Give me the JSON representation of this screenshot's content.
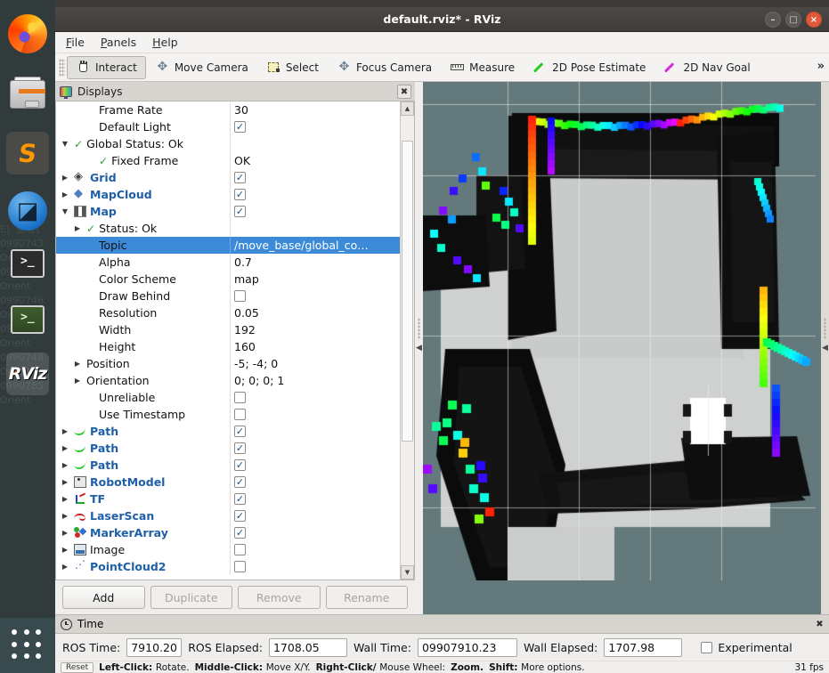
{
  "window": {
    "title": "default.rviz* - RViz",
    "minimize_label": "–",
    "maximize_label": "□",
    "close_label": "×"
  },
  "menubar": {
    "items": [
      {
        "label": "File",
        "mnemonic": "F"
      },
      {
        "label": "Panels",
        "mnemonic": "P"
      },
      {
        "label": "Help",
        "mnemonic": "H"
      }
    ]
  },
  "toolbar": {
    "overflow_label": "»",
    "tools": [
      {
        "label": "Interact",
        "icon": "hand-icon",
        "active": true
      },
      {
        "label": "Move Camera",
        "icon": "move-camera-icon",
        "active": false
      },
      {
        "label": "Select",
        "icon": "select-icon",
        "active": false
      },
      {
        "label": "Focus Camera",
        "icon": "focus-camera-icon",
        "active": false
      },
      {
        "label": "Measure",
        "icon": "ruler-icon",
        "active": false
      },
      {
        "label": "2D Pose Estimate",
        "icon": "green-arrow-icon",
        "active": false,
        "color": "#22cc22"
      },
      {
        "label": "2D Nav Goal",
        "icon": "magenta-arrow-icon",
        "active": false,
        "color": "#d22fd2"
      }
    ]
  },
  "displays_panel": {
    "title": "Displays",
    "close_label": "✖",
    "rows": [
      {
        "indent": 2,
        "arrow": "none",
        "status": "",
        "icon": "",
        "name": "Frame Rate",
        "name_style": "plain",
        "value": "30",
        "value_type": "text"
      },
      {
        "indent": 2,
        "arrow": "none",
        "status": "",
        "icon": "",
        "name": "Default Light",
        "name_style": "plain",
        "value": "checked",
        "value_type": "checkbox"
      },
      {
        "indent": 0,
        "arrow": "down",
        "status": "ok",
        "icon": "",
        "name": "Global Status: Ok",
        "name_style": "plain",
        "value": "",
        "value_type": "none"
      },
      {
        "indent": 2,
        "arrow": "none",
        "status": "ok",
        "icon": "",
        "name": "Fixed Frame",
        "name_style": "plain",
        "value": "OK",
        "value_type": "text"
      },
      {
        "indent": 0,
        "arrow": "right",
        "status": "",
        "icon": "grid",
        "name": "Grid",
        "name_style": "display",
        "value": "checked",
        "value_type": "checkbox"
      },
      {
        "indent": 0,
        "arrow": "right",
        "status": "",
        "icon": "mapcloud",
        "name": "MapCloud",
        "name_style": "display",
        "value": "checked",
        "value_type": "checkbox"
      },
      {
        "indent": 0,
        "arrow": "down",
        "status": "",
        "icon": "map",
        "name": "Map",
        "name_style": "display",
        "value": "checked",
        "value_type": "checkbox"
      },
      {
        "indent": 1,
        "arrow": "right",
        "status": "ok",
        "icon": "",
        "name": "Status: Ok",
        "name_style": "plain",
        "value": "",
        "value_type": "none"
      },
      {
        "indent": 2,
        "arrow": "none",
        "status": "",
        "icon": "",
        "name": "Topic",
        "name_style": "plain",
        "value": "/move_base/global_co…",
        "value_type": "text",
        "selected": true
      },
      {
        "indent": 2,
        "arrow": "none",
        "status": "",
        "icon": "",
        "name": "Alpha",
        "name_style": "plain",
        "value": "0.7",
        "value_type": "text"
      },
      {
        "indent": 2,
        "arrow": "none",
        "status": "",
        "icon": "",
        "name": "Color Scheme",
        "name_style": "plain",
        "value": "map",
        "value_type": "text"
      },
      {
        "indent": 2,
        "arrow": "none",
        "status": "",
        "icon": "",
        "name": "Draw Behind",
        "name_style": "plain",
        "value": "unchecked",
        "value_type": "checkbox"
      },
      {
        "indent": 2,
        "arrow": "none",
        "status": "",
        "icon": "",
        "name": "Resolution",
        "name_style": "plain",
        "value": "0.05",
        "value_type": "text"
      },
      {
        "indent": 2,
        "arrow": "none",
        "status": "",
        "icon": "",
        "name": "Width",
        "name_style": "plain",
        "value": "192",
        "value_type": "text"
      },
      {
        "indent": 2,
        "arrow": "none",
        "status": "",
        "icon": "",
        "name": "Height",
        "name_style": "plain",
        "value": "160",
        "value_type": "text"
      },
      {
        "indent": 1,
        "arrow": "right",
        "status": "",
        "icon": "",
        "name": "Position",
        "name_style": "plain",
        "value": "-5; -4; 0",
        "value_type": "text"
      },
      {
        "indent": 1,
        "arrow": "right",
        "status": "",
        "icon": "",
        "name": "Orientation",
        "name_style": "plain",
        "value": "0; 0; 0; 1",
        "value_type": "text"
      },
      {
        "indent": 2,
        "arrow": "none",
        "status": "",
        "icon": "",
        "name": "Unreliable",
        "name_style": "plain",
        "value": "unchecked",
        "value_type": "checkbox"
      },
      {
        "indent": 2,
        "arrow": "none",
        "status": "",
        "icon": "",
        "name": "Use Timestamp",
        "name_style": "plain",
        "value": "unchecked",
        "value_type": "checkbox"
      },
      {
        "indent": 0,
        "arrow": "right",
        "status": "",
        "icon": "path",
        "name": "Path",
        "name_style": "display",
        "value": "checked",
        "value_type": "checkbox"
      },
      {
        "indent": 0,
        "arrow": "right",
        "status": "",
        "icon": "path",
        "name": "Path",
        "name_style": "display",
        "value": "checked",
        "value_type": "checkbox"
      },
      {
        "indent": 0,
        "arrow": "right",
        "status": "",
        "icon": "path",
        "name": "Path",
        "name_style": "display",
        "value": "checked",
        "value_type": "checkbox"
      },
      {
        "indent": 0,
        "arrow": "right",
        "status": "",
        "icon": "robot",
        "name": "RobotModel",
        "name_style": "display",
        "value": "checked",
        "value_type": "checkbox"
      },
      {
        "indent": 0,
        "arrow": "right",
        "status": "",
        "icon": "tf",
        "name": "TF",
        "name_style": "display",
        "value": "checked",
        "value_type": "checkbox"
      },
      {
        "indent": 0,
        "arrow": "right",
        "status": "",
        "icon": "laser",
        "name": "LaserScan",
        "name_style": "display",
        "value": "checked",
        "value_type": "checkbox"
      },
      {
        "indent": 0,
        "arrow": "right",
        "status": "",
        "icon": "marker",
        "name": "MarkerArray",
        "name_style": "display",
        "value": "checked",
        "value_type": "checkbox"
      },
      {
        "indent": 0,
        "arrow": "right",
        "status": "",
        "icon": "image",
        "name": "Image",
        "name_style": "plain",
        "value": "unchecked",
        "value_type": "checkbox"
      },
      {
        "indent": 0,
        "arrow": "right",
        "status": "",
        "icon": "pc2",
        "name": "PointCloud2",
        "name_style": "display",
        "value": "unchecked",
        "value_type": "checkbox"
      }
    ],
    "buttons": [
      {
        "label": "Add",
        "enabled": true
      },
      {
        "label": "Duplicate",
        "enabled": false
      },
      {
        "label": "Remove",
        "enabled": false
      },
      {
        "label": "Rename",
        "enabled": false
      }
    ],
    "scroll_up_label": "▲",
    "scroll_down_label": "▼"
  },
  "time_panel": {
    "title": "Time",
    "close_label": "✖",
    "fields": [
      {
        "label": "ROS Time:",
        "value": "7910.20",
        "key": "ros_time"
      },
      {
        "label": "ROS Elapsed:",
        "value": "1708.05",
        "key": "ros_elapsed"
      },
      {
        "label": "Wall Time:",
        "value": "09907910.23",
        "key": "wall_time"
      },
      {
        "label": "Wall Elapsed:",
        "value": "1707.98",
        "key": "wall_elapsed"
      }
    ],
    "experimental_label": "Experimental",
    "experimental_checked": false
  },
  "statusbar": {
    "reset_label": "Reset",
    "hints": [
      {
        "bold": "Left-Click:",
        "text": "Rotate."
      },
      {
        "bold": "Middle-Click:",
        "text": "Move X/Y."
      },
      {
        "bold": "Right-Click/",
        "text": "Mouse Wheel:"
      },
      {
        "bold": "Zoom.",
        "text": ""
      },
      {
        "bold": "Shift:",
        "text": "More options."
      }
    ],
    "fps": "31 fps"
  },
  "view3d": {
    "background_color": "#64797b",
    "grid_color": "#e8eced",
    "collapse_left_label": "◀",
    "collapse_right_label": "◀"
  },
  "dock": {
    "items": [
      {
        "name": "firefox",
        "label": "Firefox"
      },
      {
        "name": "files",
        "label": "Files"
      },
      {
        "name": "sublime-text",
        "label": "Sublime Text"
      },
      {
        "name": "zoom",
        "label": "Zoom"
      },
      {
        "name": "terminal-dark",
        "label": "Terminal"
      },
      {
        "name": "terminal-green",
        "label": "Terminal"
      },
      {
        "name": "rviz",
        "label": "RViz"
      }
    ],
    "show_apps_label": "Show Applications",
    "rviz_badge": "RViz"
  },
  "background_terminal": {
    "lines": [
      "E)  查看(",
      "0990743",
      "Orient",
      "0990745",
      "Orient",
      "0990746",
      "Orient",
      "0990747",
      "Orient",
      "0990748",
      "Orient",
      "0990785",
      "Orient"
    ]
  }
}
